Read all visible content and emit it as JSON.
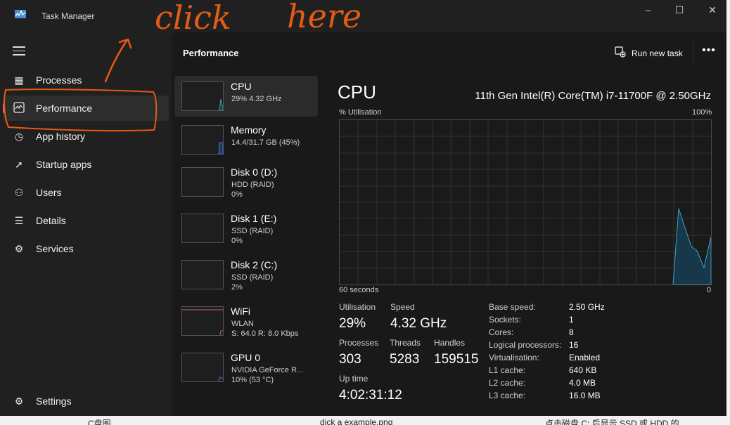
{
  "window": {
    "title": "Task Manager"
  },
  "sidebar": {
    "items": [
      {
        "label": "Processes",
        "icon": "processes-icon"
      },
      {
        "label": "Performance",
        "icon": "performance-icon",
        "active": true
      },
      {
        "label": "App history",
        "icon": "history-icon"
      },
      {
        "label": "Startup apps",
        "icon": "startup-icon"
      },
      {
        "label": "Users",
        "icon": "users-icon"
      },
      {
        "label": "Details",
        "icon": "details-icon"
      },
      {
        "label": "Services",
        "icon": "services-icon"
      }
    ],
    "settings_label": "Settings"
  },
  "header": {
    "title": "Performance",
    "run_task_label": "Run new task",
    "more_label": "•••"
  },
  "devices": [
    {
      "name": "CPU",
      "sub1": "29%  4.32 GHz",
      "sub2": ""
    },
    {
      "name": "Memory",
      "sub1": "14.4/31.7 GB (45%)",
      "sub2": ""
    },
    {
      "name": "Disk 0 (D:)",
      "sub1": "HDD (RAID)",
      "sub2": "0%"
    },
    {
      "name": "Disk 1 (E:)",
      "sub1": "SSD (RAID)",
      "sub2": "0%"
    },
    {
      "name": "Disk 2 (C:)",
      "sub1": "SSD (RAID)",
      "sub2": "2%"
    },
    {
      "name": "WiFi",
      "sub1": "WLAN",
      "sub2": "S: 64.0  R: 8.0 Kbps"
    },
    {
      "name": "GPU 0",
      "sub1": "NVIDIA GeForce R...",
      "sub2": "10%  (53 °C)"
    }
  ],
  "detail": {
    "title": "CPU",
    "model": "11th Gen Intel(R) Core(TM) i7-11700F @ 2.50GHz",
    "y_label": "% Utilisation",
    "y_max": "100%",
    "x_label": "60 seconds",
    "x_min": "0",
    "stats": {
      "utilisation_label": "Utilisation",
      "utilisation": "29%",
      "speed_label": "Speed",
      "speed": "4.32 GHz",
      "processes_label": "Processes",
      "processes": "303",
      "threads_label": "Threads",
      "threads": "5283",
      "handles_label": "Handles",
      "handles": "159515",
      "uptime_label": "Up time",
      "uptime": "4:02:31:12"
    },
    "specs": [
      {
        "key": "Base speed:",
        "value": "2.50 GHz"
      },
      {
        "key": "Sockets:",
        "value": "1"
      },
      {
        "key": "Cores:",
        "value": "8"
      },
      {
        "key": "Logical processors:",
        "value": "16"
      },
      {
        "key": "Virtualisation:",
        "value": "Enabled"
      },
      {
        "key": "L1 cache:",
        "value": "640 KB"
      },
      {
        "key": "L2 cache:",
        "value": "4.0 MB"
      },
      {
        "key": "L3 cache:",
        "value": "16.0 MB"
      }
    ]
  },
  "annotation": {
    "text_click": "click",
    "text_here": "here"
  },
  "background_text": {
    "left": "C盘图",
    "mid": "dick a example.png",
    "right": "点击磁盘 C: 后显示 SSD 或 HDD 的"
  },
  "colors": {
    "accent": "#e65a8c",
    "cpu_line": "#3aa6c9",
    "annotation": "#e35b14"
  }
}
